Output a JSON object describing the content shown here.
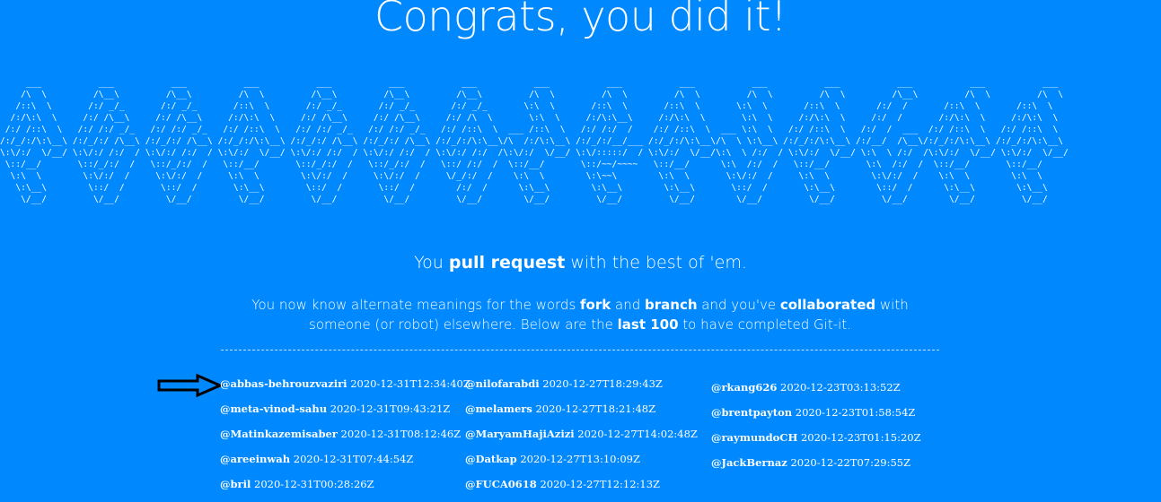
{
  "page": {
    "headline": "Congrats, you did it!",
    "tagline": {
      "pre": "You ",
      "strong": "pull request",
      "post": " with the best of 'em."
    },
    "description": {
      "p1": "You now know alternate meanings for the words ",
      "s1": "fork",
      "p2": " and ",
      "s2": "branch",
      "p3": " and you've ",
      "s3": "collaborated",
      "p4": " with someone (or robot) elsewhere. Below are the ",
      "s4": "last 100",
      "p5": " to have completed Git-it."
    }
  },
  "ascii_art": "     ___           ___           ___           ___           ___           ___           ___           ___           ___           ___           ___           ___           ___           ___           ___     \n    /\\  \\         /\\__\\         /\\__\\         /\\  \\         /\\__\\         /\\__\\         /\\__\\         /\\  \\         /\\  \\         /\\  \\         /\\  \\         /\\  \\         /\\__\\         /\\  \\         /\\  \\    \n   /::\\  \\       /:/ _/_       /:/ _/_       /::\\  \\       /:/ _/_       /:/ _/_       /:/ _/_       \\:\\  \\       /::\\  \\       /::\\  \\       \\:\\  \\       /::\\  \\       /:/  /       /::\\  \\       /::\\  \\   \n  /:/\\:\\  \\     /:/ /\\__\\     /:/ /\\__\\     /:/\\:\\  \\     /:/ /\\__\\     /:/ /\\__\\     /:/ /\\  \\       \\:\\  \\     /:/\\:\\__\\     /:/\\:\\  \\       \\:\\  \\     /:/\\:\\  \\     /:/  /       /:/\\:\\  \\     /:/\\:\\  \\  \n /:/ /::\\  \\   /:/ /:/ _/_   /:/ /:/ _/_   /:/ /::\\  \\   /:/ /:/ _/_   /:/ /:/ _/_   /:/ /::\\  \\  ___ /::\\  \\   /:/ /:/  /    /:/ /::\\  \\  ___ \\:\\  \\   /:/ /::\\  \\   /:/  /  ___  /:/ /::\\  \\   /:/ /::\\  \\ \n/:/_/:/\\:\\__\\ /:/_/:/ /\\__\\ /:/_/:/ /\\__\\ /:/_/:/\\:\\__\\ /:/_/:/ /\\__\\ /:/_/:/ /\\__\\ /:/_/:/\\:\\__\\/\\  /:/\\:\\__\\ /:/_/:/__/___ /:/_/:/\\:\\__\\/\\  \\ \\:\\__\\ /:/_/:/\\:\\__\\ /:/__/  /\\__\\/:/_/:/\\:\\__\\ /:/_/:/\\:\\__\\\n\\:\\/:/  \\/__/ \\:\\/:/ /:/  / \\:\\/:/ /:/  / \\:\\/:/  \\/__/ \\:\\/:/ /:/  / \\:\\/:/ /:/  / \\:\\/:/ /:/  /\\:\\/:/  \\/__/ \\:\\/:::::/  / \\:\\/:/  \\/__/\\:\\  \\ /:/  / \\:\\/:/  \\/__/ \\:\\  \\ /:/  /\\:\\/:/  \\/__/ \\:\\/:/  \\/__/\n \\::/__/       \\::/_/:/  /   \\::/_/:/  /   \\::/__/       \\::/_/:/  /   \\::/_/:/  /   \\::/ /:/  /  \\::/__/       \\::/~~/~~~~   \\::/__/      \\:\\  /:/  /   \\::/__/       \\:\\  /:/  /  \\::/__/       \\::/__/     \n  \\:\\  \\        \\:\\/:/  /     \\:\\/:/  /     \\:\\  \\        \\:\\/:/  /     \\:\\/:/  /     \\/_/:/  /    \\:\\  \\        \\:\\~~\\        \\:\\  \\       \\:\\/:/  /     \\:\\  \\        \\:\\/:/  /    \\:\\  \\        \\:\\  \\     \n   \\:\\__\\        \\::/  /       \\::/  /       \\:\\__\\        \\::/  /       \\::/  /        /:/  /      \\:\\__\\        \\:\\__\\        \\:\\__\\       \\::/  /       \\:\\__\\        \\::/  /      \\:\\__\\        \\:\\__\\    \n    \\/__/         \\/__/         \\/__/         \\/__/         \\/__/         \\/__/         \\/__/        \\/__/         \\/__/         \\/__/        \\/__/         \\/__/         \\/__/        \\/__/         \\/__/    ",
  "completers": {
    "col1": [
      {
        "user": "@abbas-behrouzvaziri",
        "time": "2020-12-31T12:34:40Z"
      },
      {
        "user": "@meta-vinod-sahu",
        "time": "2020-12-31T09:43:21Z"
      },
      {
        "user": "@Matinkazemisaber",
        "time": "2020-12-31T08:12:46Z"
      },
      {
        "user": "@areeinwah",
        "time": "2020-12-31T07:44:54Z"
      },
      {
        "user": "@bril",
        "time": "2020-12-31T00:28:26Z"
      }
    ],
    "col2": [
      {
        "user": "@nilofarabdi",
        "time": "2020-12-27T18:29:43Z"
      },
      {
        "user": "@melamers",
        "time": "2020-12-27T18:21:48Z"
      },
      {
        "user": "@MaryamHajiAzizi",
        "time": "2020-12-27T14:02:48Z"
      },
      {
        "user": "@Datkap",
        "time": "2020-12-27T13:10:09Z"
      },
      {
        "user": "@FUCA0618",
        "time": "2020-12-27T12:12:13Z"
      }
    ],
    "col3": [
      {
        "user": "@rkang626",
        "time": "2020-12-23T03:13:52Z"
      },
      {
        "user": "@brentpayton",
        "time": "2020-12-23T01:58:54Z"
      },
      {
        "user": "@raymundoCH",
        "time": "2020-12-23T01:15:20Z"
      },
      {
        "user": "@JackBernaz",
        "time": "2020-12-22T07:29:55Z"
      }
    ]
  },
  "icons": {
    "pointer": "arrow-right-icon"
  },
  "colors": {
    "background": "#0088ff",
    "text": "#ffffff",
    "arrow_fill": "#0088ff",
    "arrow_stroke": "#000000"
  }
}
